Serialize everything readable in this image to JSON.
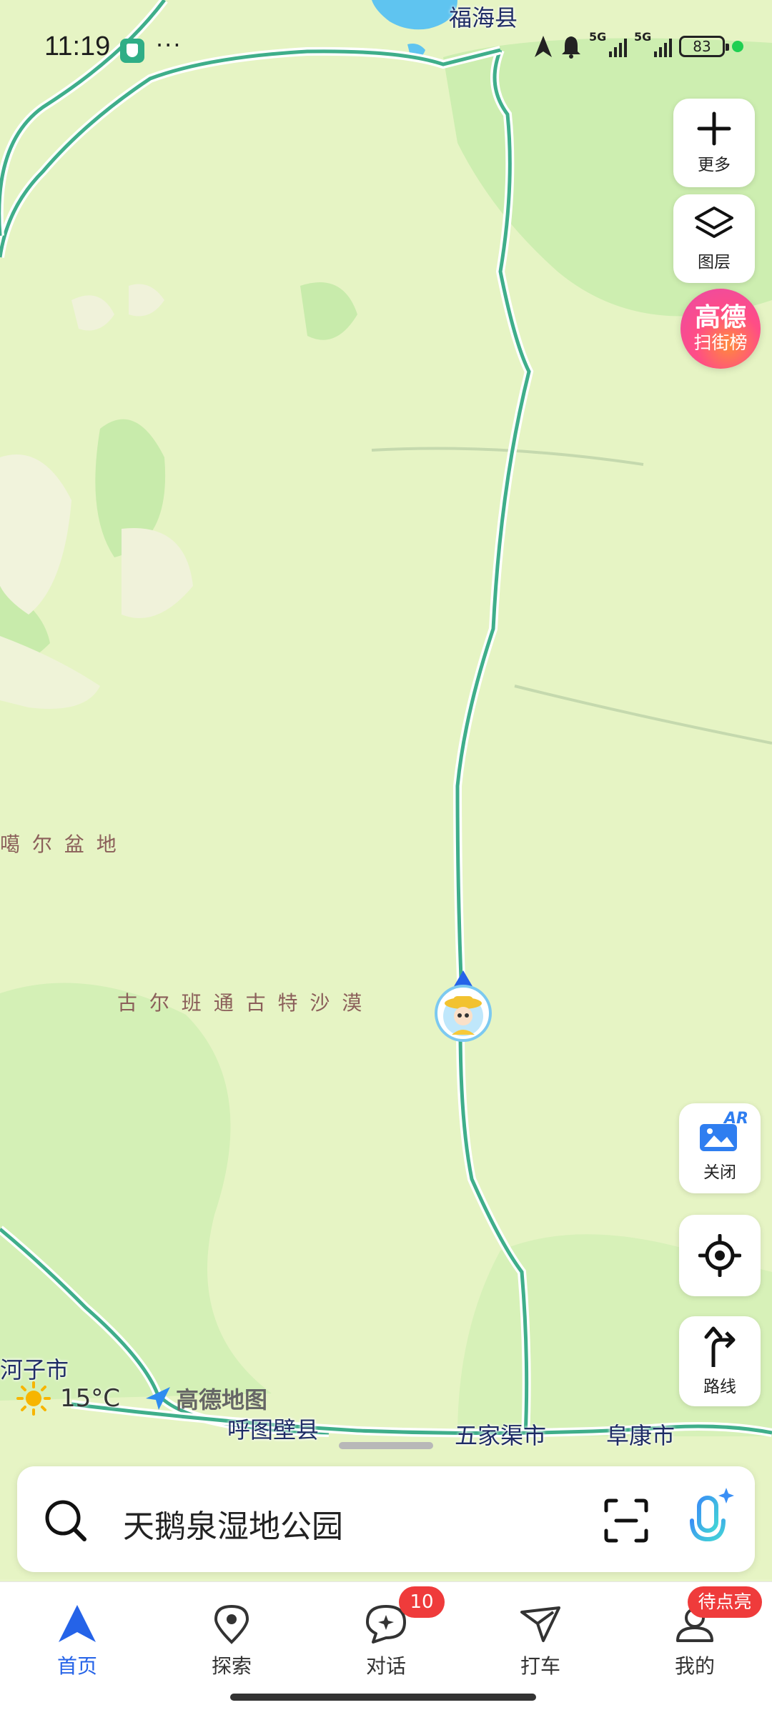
{
  "status_bar": {
    "time": "11:19",
    "more": "···",
    "signal1": "5G",
    "signal2": "5G",
    "battery": "83"
  },
  "map": {
    "labels": {
      "fuhai": "福海县",
      "basin": "噶 尔 盆 地",
      "desert": "古 尔 班 通 古 特 沙 漠",
      "hezi": "河子市",
      "hutubi": "呼图壁县",
      "wujiaqu": "五家渠市",
      "fukang": "阜康市"
    },
    "weather": {
      "temp": "15°C",
      "icon": "sun-icon"
    },
    "brand": "高德地图"
  },
  "controls": {
    "more_label": "更多",
    "layers_label": "图层",
    "scan_line1": "高德",
    "scan_line2": "扫街榜",
    "ar_label": "关闭",
    "ar_tag": "AR",
    "route_label": "路线"
  },
  "search": {
    "query": "天鹅泉湿地公园"
  },
  "nav": {
    "items": [
      {
        "label": "首页",
        "icon": "navigation-arrow-icon"
      },
      {
        "label": "探索",
        "icon": "location-pin-icon"
      },
      {
        "label": "对话",
        "icon": "chat-bubble-icon"
      },
      {
        "label": "打车",
        "icon": "taxi-icon"
      },
      {
        "label": "我的",
        "icon": "profile-icon"
      }
    ],
    "chat_badge": "10",
    "mine_badge": "待点亮"
  },
  "colors": {
    "accent": "#2563e8",
    "map_bg": "#e8f5c8",
    "road": "#3fae8a",
    "badge": "#ef3b3b"
  }
}
